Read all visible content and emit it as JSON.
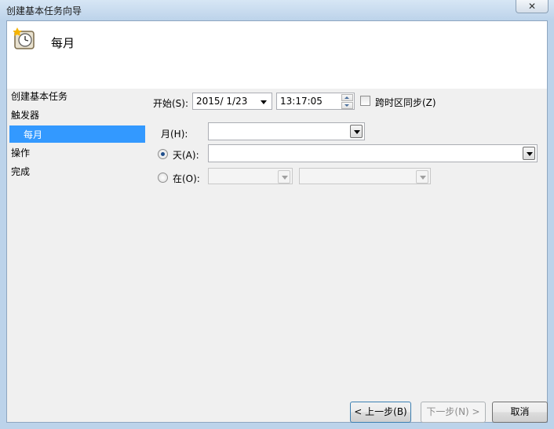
{
  "window": {
    "title": "创建基本任务向导",
    "close_label": "✕"
  },
  "header": {
    "title": "每月"
  },
  "nav": {
    "items": [
      "创建基本任务",
      "触发器",
      "每月",
      "操作",
      "完成"
    ],
    "selected_index": 2
  },
  "form": {
    "start_label": "开始(S):",
    "start_date": "2015/ 1/23",
    "start_time": "13:17:05",
    "sync_label": "跨时区同步(Z)",
    "sync_checked": false,
    "month_label": "月(H):",
    "month_value": "",
    "day_label": "天(A):",
    "day_value": "",
    "day_selected": true,
    "on_label": "在(O):",
    "on_selected": false
  },
  "buttons": {
    "back": "< 上一步(B)",
    "next": "下一步(N) >",
    "cancel": "取消"
  }
}
